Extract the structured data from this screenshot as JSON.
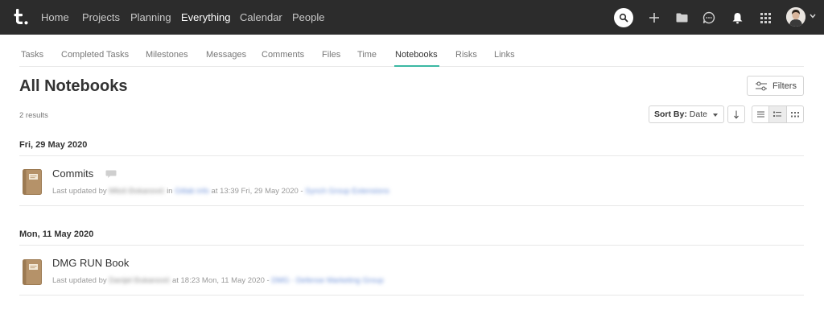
{
  "topbar": {
    "logo_letter": "t.",
    "nav": [
      {
        "label": "Home",
        "active": false
      },
      {
        "label": "Projects",
        "active": false
      },
      {
        "label": "Planning",
        "active": false
      },
      {
        "label": "Everything",
        "active": true
      },
      {
        "label": "Calendar",
        "active": false
      },
      {
        "label": "People",
        "active": false
      }
    ],
    "icons": [
      "search-icon",
      "plus-icon",
      "folder-icon",
      "chat-icon",
      "bell-icon",
      "apps-grid-icon",
      "avatar",
      "chevron-down-icon"
    ]
  },
  "tabs": [
    {
      "label": "Tasks",
      "active": false
    },
    {
      "label": "Completed Tasks",
      "active": false
    },
    {
      "label": "Milestones",
      "active": false
    },
    {
      "label": "Messages",
      "active": false
    },
    {
      "label": "Comments",
      "active": false
    },
    {
      "label": "Files",
      "active": false
    },
    {
      "label": "Time",
      "active": false
    },
    {
      "label": "Notebooks",
      "active": true
    },
    {
      "label": "Risks",
      "active": false
    },
    {
      "label": "Links",
      "active": false
    }
  ],
  "header": {
    "title": "All Notebooks",
    "filters_label": "Filters",
    "results": "2 results",
    "sort_by_label": "Sort By:",
    "sort_value": "Date"
  },
  "colors": {
    "topbar_bg": "#2c2c2c",
    "accent": "#3bb8a3",
    "notebook_brown": "#b59269"
  },
  "groups": [
    {
      "date": "Fri, 29 May 2020",
      "notebooks": [
        {
          "title": "Commits",
          "has_comments_icon": true,
          "meta_prefix": "Last updated by",
          "author": "Miloš Đokanović",
          "in_text": "in",
          "project": "Gitlab info",
          "time_text": "at 13:39 Fri, 29 May 2020 -",
          "company": "Synch Group Extensions"
        }
      ]
    },
    {
      "date": "Mon, 11 May 2020",
      "notebooks": [
        {
          "title": "DMG RUN Book",
          "has_comments_icon": false,
          "meta_prefix": "Last updated by",
          "author": "Danijel Đukanović",
          "in_text": "",
          "project": "",
          "time_text": "at 18:23 Mon, 11 May 2020 -",
          "company": "DMG - Defense Marketing Group"
        }
      ]
    }
  ]
}
